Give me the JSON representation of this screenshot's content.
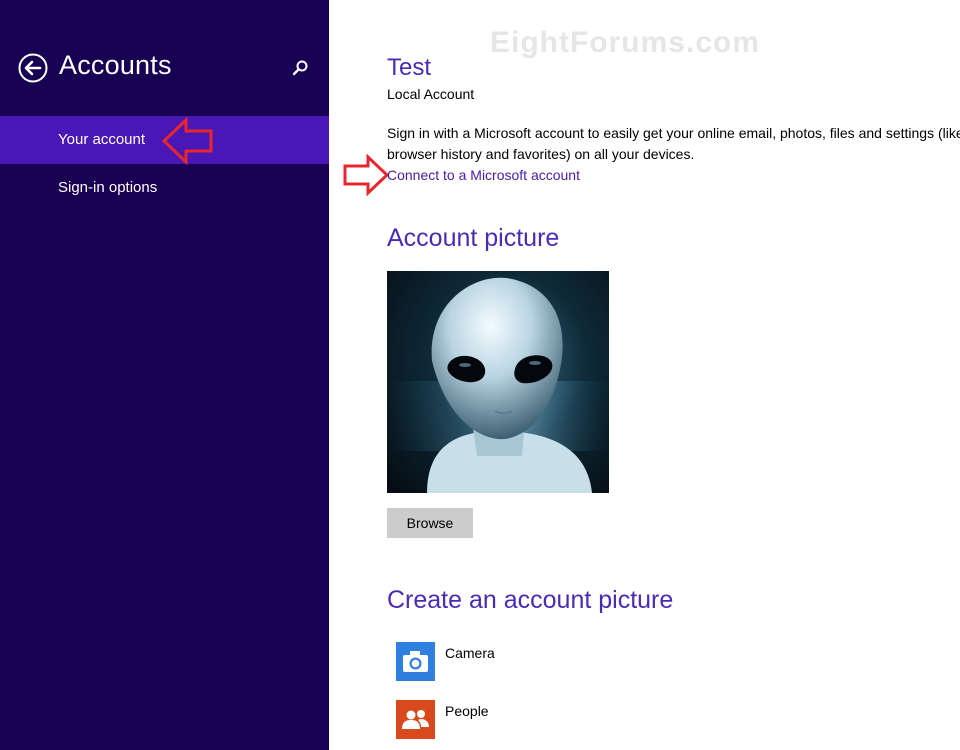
{
  "sidebar": {
    "title": "Accounts",
    "items": [
      {
        "label": "Your account",
        "selected": true
      },
      {
        "label": "Sign-in options",
        "selected": false
      }
    ],
    "bg_color": "#180052",
    "selected_color": "#4a16b5"
  },
  "watermark": "EightForums.com",
  "account": {
    "name": "Test",
    "type": "Local Account",
    "description_line1": "Sign in with a Microsoft account to easily get your online email, photos, files and settings (like",
    "description_line2": "browser history and favorites) on all your devices.",
    "connect_link": "Connect to a Microsoft account"
  },
  "account_picture": {
    "heading": "Account picture",
    "browse_label": "Browse"
  },
  "create_picture": {
    "heading": "Create an account picture",
    "apps": [
      {
        "label": "Camera",
        "icon": "camera-icon",
        "color": "#2f7fe0"
      },
      {
        "label": "People",
        "icon": "people-icon",
        "color": "#d84a1b"
      }
    ]
  },
  "accent_color": "#4a2bb3"
}
